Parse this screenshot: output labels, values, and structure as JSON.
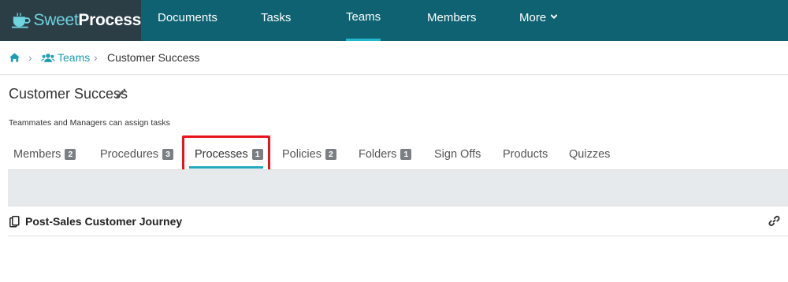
{
  "brand": {
    "name_part1": "Sweet",
    "name_part2": "Process",
    "colors": {
      "topbar": "#0e6271",
      "logo_bg": "#2b3e46",
      "accent": "#22b8cf",
      "highlight": "#e8131b"
    }
  },
  "nav": {
    "items": [
      {
        "label": "Documents"
      },
      {
        "label": "Tasks"
      },
      {
        "label": "Teams",
        "active": true
      },
      {
        "label": "Members"
      },
      {
        "label": "More",
        "icon": "chevron-down-icon"
      }
    ]
  },
  "breadcrumb": {
    "home_icon": "home-icon",
    "teams_icon": "users-icon",
    "teams_label": "Teams",
    "separator": "›",
    "current": "Customer Success"
  },
  "page": {
    "title": "Customer Success",
    "edit_icon": "pencil-icon",
    "subtitle": "Teammates and Managers can assign tasks"
  },
  "tabs": [
    {
      "label": "Members",
      "badge": "2"
    },
    {
      "label": "Procedures",
      "badge": "3"
    },
    {
      "label": "Processes",
      "badge": "1",
      "active": true
    },
    {
      "label": "Policies",
      "badge": "2"
    },
    {
      "label": "Folders",
      "badge": "1"
    },
    {
      "label": "Sign Offs"
    },
    {
      "label": "Products"
    },
    {
      "label": "Quizzes"
    }
  ],
  "list": {
    "items": [
      {
        "title": "Post-Sales Customer Journey",
        "icon": "copy-icon",
        "action_icon": "link-icon"
      }
    ]
  }
}
